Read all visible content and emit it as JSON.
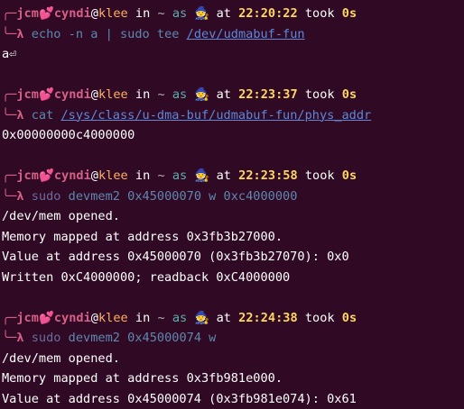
{
  "prompt": {
    "user": "jcm",
    "heart": "💕",
    "name": "cyndi",
    "at_sign": "@",
    "host": "klee",
    "in_word": " in ",
    "dir": "~",
    "as_word": " as ",
    "wizard": "🧙",
    "at_word": " at ",
    "took_word": " took ",
    "corner_top": "╭─",
    "corner_bottom": "╰─",
    "lambda": "λ"
  },
  "blocks": [
    {
      "time": "22:20:22",
      "took": "0s",
      "cmd_parts": [
        {
          "text": "echo",
          "cls": "cmdblue"
        },
        {
          "text": " -n a | ",
          "cls": "cmdblue"
        },
        {
          "text": "sudo",
          "cls": "cmdblue"
        },
        {
          "text": " tee ",
          "cls": "cmdblue"
        },
        {
          "text": "/dev/udmabuf-fun",
          "cls": "link"
        }
      ],
      "output": [
        "a⏎"
      ]
    },
    {
      "time": "22:23:37",
      "took": "0s",
      "cmd_parts": [
        {
          "text": "cat",
          "cls": "cmdblue"
        },
        {
          "text": " ",
          "cls": "cmdblue"
        },
        {
          "text": "/sys/class/u-dma-buf/udmabuf-fun/phys_addr",
          "cls": "link"
        }
      ],
      "output": [
        "0x00000000c4000000"
      ]
    },
    {
      "time": "22:23:58",
      "took": "0s",
      "cmd_parts": [
        {
          "text": "sudo",
          "cls": "dim"
        },
        {
          "text": " devmem2 0x45000070 w 0xc4000000",
          "cls": "cmdblue"
        }
      ],
      "output": [
        "/dev/mem opened.",
        "Memory mapped at address 0x3fb3b27000.",
        "Value at address 0x45000070 (0x3fb3b27070): 0x0",
        "Written 0xC4000000; readback 0xC4000000"
      ]
    },
    {
      "time": "22:24:38",
      "took": "0s",
      "cmd_parts": [
        {
          "text": "sudo",
          "cls": "dim"
        },
        {
          "text": " devmem2 0x45000074 w",
          "cls": "cmdblue"
        }
      ],
      "output": [
        "/dev/mem opened.",
        "Memory mapped at address 0x3fb981e000.",
        "Value at address 0x45000074 (0x3fb981e074): 0x61"
      ]
    }
  ],
  "colors": {
    "background": "#300a24",
    "user": "#d75f87",
    "host": "#ffaf5f",
    "time": "#ffd75f",
    "took": "#ffd75f",
    "command": "#5f87af"
  }
}
